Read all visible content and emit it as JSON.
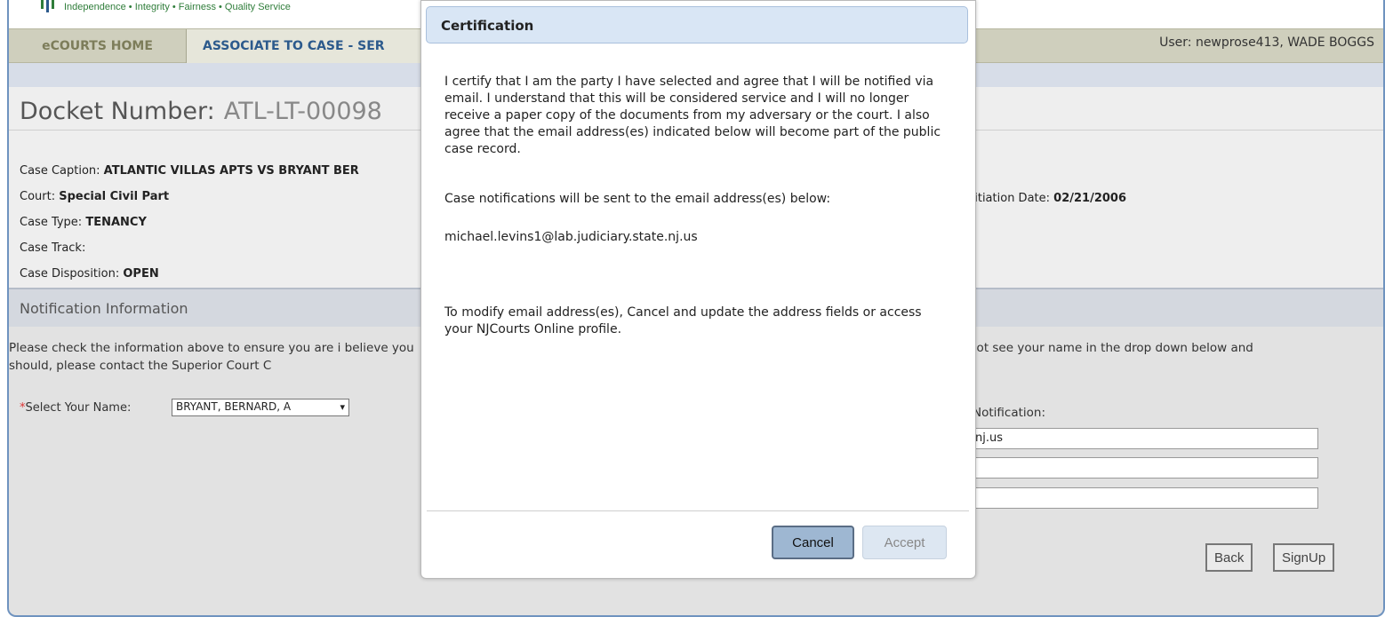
{
  "banner": {
    "tagline": "Independence • Integrity • Fairness • Quality Service"
  },
  "nav": {
    "home": "eCOURTS HOME",
    "active": "ASSOCIATE TO CASE - SER",
    "user": "User: newprose413, WADE BOGGS"
  },
  "docket": {
    "label": "Docket Number:",
    "number": "ATL-LT-00098"
  },
  "case": {
    "caption_label": "Case Caption:",
    "caption_value": "ATLANTIC VILLAS APTS VS BRYANT BER",
    "court_label": "Court:",
    "court_value": "Special Civil Part",
    "type_label": "Case Type:",
    "type_value": "TENANCY",
    "track_label": "Case Track:",
    "disposition_label": "Case Disposition:",
    "disposition_value": "OPEN",
    "initiation_label": "nitiation Date:",
    "initiation_value": "02/21/2006"
  },
  "notification": {
    "header": "Notification Information",
    "info_left": "Please check the information above to ensure you are i believe you should, please contact the Superior Court C",
    "info_right": "not see your name in the drop down below and",
    "select_required": "*",
    "select_label": "Select Your Name:",
    "select_value": "BRYANT, BERNARD, A",
    "notif_label": "Notification:",
    "email_values": [
      "nj.us",
      "",
      ""
    ]
  },
  "page_buttons": {
    "back": "Back",
    "signup": "SignUp"
  },
  "modal": {
    "title": "Certification",
    "paragraph1": "I certify that I am the party I have selected and agree that I will be notified via email. I understand that this will be considered service and I will no longer receive a paper copy of the documents from my adversary or the court. I also agree that the email address(es) indicated below will become part of the public case record.",
    "paragraph2": "Case notifications will be sent to the email address(es) below:",
    "email": "michael.levins1@lab.judiciary.state.nj.us",
    "paragraph3": "To modify email address(es), Cancel and update the address fields or access your NJCourts Online profile.",
    "cancel_label": "Cancel",
    "accept_label": "Accept"
  }
}
